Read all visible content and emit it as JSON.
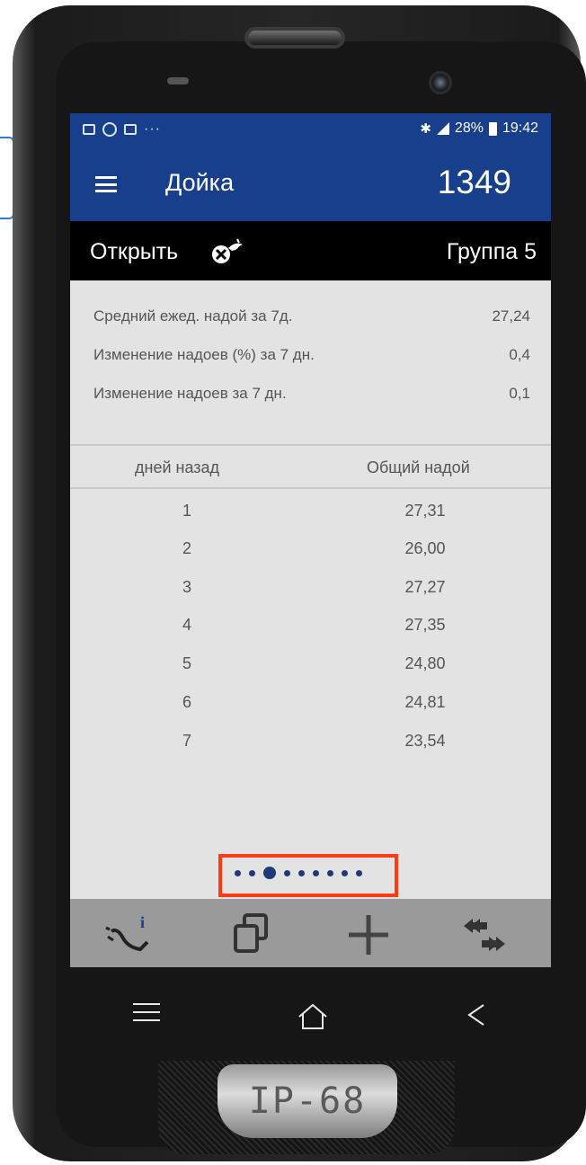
{
  "statusbar": {
    "notification_dots": "···",
    "battery_percent": "28%",
    "time": "19:42"
  },
  "appbar": {
    "title": "Дойка",
    "count": "1349"
  },
  "subheader": {
    "open_label": "Открыть",
    "group_label": "Группа 5"
  },
  "stats": [
    {
      "label": "Средний ежед. надой за 7д.",
      "value": "27,24"
    },
    {
      "label": "Изменение надоев (%) за 7 дн.",
      "value": "0,4"
    },
    {
      "label": "Изменение надоев за 7 дн.",
      "value": "0,1"
    }
  ],
  "table": {
    "headers": [
      "дней назад",
      "Общий надой"
    ],
    "rows": [
      [
        "1",
        "27,31"
      ],
      [
        "2",
        "26,00"
      ],
      [
        "3",
        "27,27"
      ],
      [
        "4",
        "27,35"
      ],
      [
        "5",
        "24,80"
      ],
      [
        "6",
        "24,81"
      ],
      [
        "7",
        "23,54"
      ]
    ]
  },
  "pager": {
    "total": 9,
    "active_index": 2
  },
  "toolbar": {
    "icons": [
      "cow-info-icon",
      "copy-icon",
      "add-icon",
      "swap-arrows-icon"
    ]
  },
  "device": {
    "badge": "IP-68"
  },
  "colors": {
    "primary": "#173f8c",
    "toolbar": "#9a9a9a",
    "highlight": "#ff3b14"
  }
}
